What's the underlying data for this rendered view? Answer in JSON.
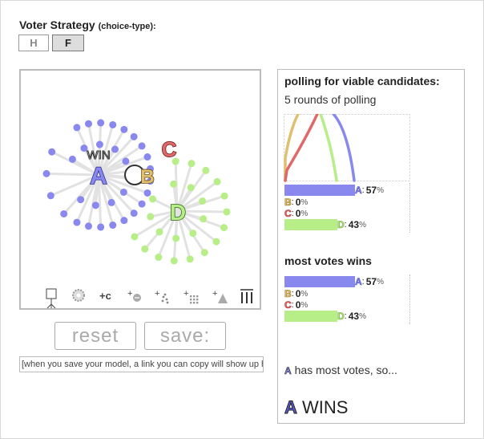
{
  "colors": {
    "A": "#8888ee",
    "B": "#e0c070",
    "C": "#e06868",
    "D": "#b8ee88",
    "A_dark": "#5050c8",
    "B_dark": "#a07828",
    "C_dark": "#b03838",
    "D_dark": "#68a038"
  },
  "strategy": {
    "title": "Voter Strategy",
    "subtitle": "(choice-type):",
    "buttons": [
      {
        "label": "H",
        "active": false
      },
      {
        "label": "F",
        "active": true
      }
    ]
  },
  "sim": {
    "win_label": "WIN",
    "candidates": [
      {
        "letter": "A"
      },
      {
        "letter": "B"
      },
      {
        "letter": "C"
      },
      {
        "letter": "D"
      }
    ],
    "toolbar": [
      "pin-icon",
      "gear-icon",
      "add-candidate-icon",
      "add-voter-icon",
      "add-voter-cloud-icon",
      "add-voter-grid-icon",
      "add-triangle-icon",
      "columns-icon"
    ],
    "toolbar_labels": {
      "add_c": "+c"
    }
  },
  "controls": {
    "reset_label": "reset",
    "save_label": "save:",
    "save_link_text": "[when you save your model, a link you can copy will show up here]"
  },
  "results": {
    "polling_title": "polling for viable candidates:",
    "polling_rounds": "5 rounds of polling",
    "polling": [
      {
        "letter": "A",
        "value": 57
      },
      {
        "letter": "B",
        "value": 0
      },
      {
        "letter": "C",
        "value": 0
      },
      {
        "letter": "D",
        "value": 43
      }
    ],
    "final_title": "most votes wins",
    "final": [
      {
        "letter": "A",
        "value": 57
      },
      {
        "letter": "B",
        "value": 0
      },
      {
        "letter": "C",
        "value": 0
      },
      {
        "letter": "D",
        "value": 43
      }
    ],
    "pct_symbol": "%",
    "most_votes_text": "has most votes, so...",
    "most_votes_letter": "A",
    "winner_letter": "A",
    "winner_text": "WINS"
  }
}
